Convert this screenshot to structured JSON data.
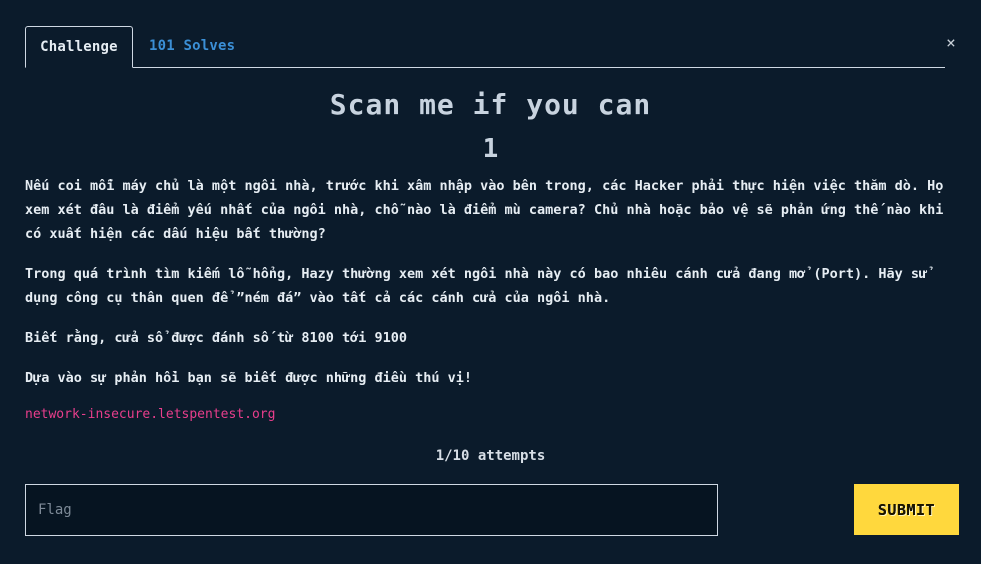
{
  "tabs": {
    "challenge_label": "Challenge",
    "solves_label": "101 Solves"
  },
  "close_icon": "×",
  "challenge": {
    "title": "Scan me if you can",
    "points": "1",
    "description": [
      "Nếu coi mỗi máy chủ là một ngôi nhà, trước khi xâm nhập vào bên trong, các Hacker phải thực hiện việc thăm dò. Họ xem xét đâu là điểm yếu nhất của ngôi nhà, chỗ nào là điểm mù camera? Chủ nhà hoặc bảo vệ sẽ phản ứng thế nào khi có xuất hiện các dấu hiệu bất thường?",
      "Trong quá trình tìm kiếm lỗ hổng, Hazy thường xem xét ngôi nhà này có bao nhiêu cánh cửa đang mở (Port). Hãy sử dụng công cụ thân quen để ”ném đá” vào tất cả các cánh cửa của ngôi nhà.",
      "Biết rằng, cửa sổ được đánh số từ 8100 tới 9100",
      "Dựa vào sự phản hồi bạn sẽ biết được những điều thú vị!"
    ],
    "host": "network-insecure.letspentest.org",
    "attempts": "1/10 attempts"
  },
  "form": {
    "flag_placeholder": "Flag",
    "flag_value": "",
    "submit_label": "SUBMIT"
  },
  "colors": {
    "background": "#0b1b2b",
    "solves_link": "#3b8fd6",
    "host_text": "#e83e8c",
    "submit_button": "#ffd83d"
  }
}
